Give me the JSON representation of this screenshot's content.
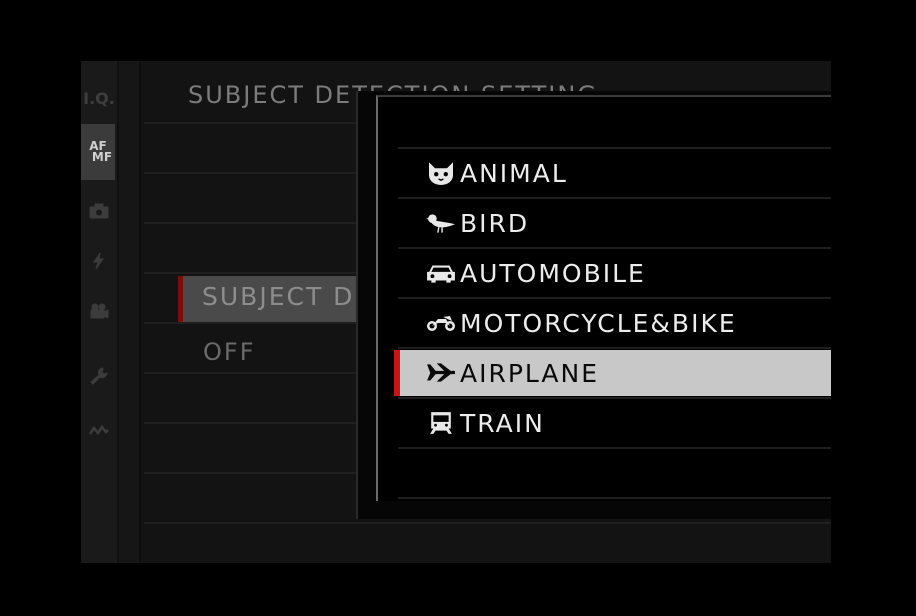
{
  "tabs": {
    "iq": "I.Q.",
    "af_line1": "AF",
    "af_line2": "MF"
  },
  "menu": {
    "title": "SUBJECT DETECTION SETTING",
    "highlighted_item": "SUBJECT DETECTION SETTING",
    "value_item": "OFF"
  },
  "popup": {
    "options": [
      {
        "label": "ANIMAL",
        "icon": "cat-icon"
      },
      {
        "label": "BIRD",
        "icon": "bird-icon"
      },
      {
        "label": "AUTOMOBILE",
        "icon": "car-icon"
      },
      {
        "label": "MOTORCYCLE&BIKE",
        "icon": "motorcycle-icon"
      },
      {
        "label": "AIRPLANE",
        "icon": "airplane-icon"
      },
      {
        "label": "TRAIN",
        "icon": "train-icon"
      }
    ],
    "selected": "AIRPLANE"
  },
  "colors": {
    "accent_red": "#c81616",
    "selection_bg": "#c8c8c8"
  }
}
